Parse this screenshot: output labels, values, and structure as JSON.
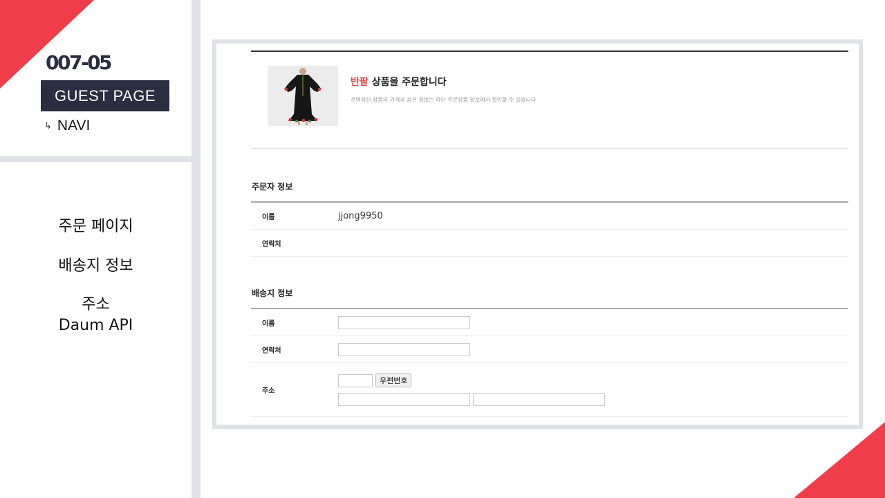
{
  "left_panel": {
    "code": "007-05",
    "badge": "GUEST PAGE",
    "navi_arrow": "↳",
    "navi": "NAVI",
    "menu": [
      {
        "label": "주문 페이지"
      },
      {
        "label": "배송지 정보"
      },
      {
        "label_line1": "주소",
        "label_line2": "Daum API"
      }
    ]
  },
  "screenshot": {
    "product": {
      "title_accent": "반팔",
      "title_rest": "상품을 주문합니다",
      "subtitle": "선택하신 상품의 가격과 옵션 정보는 하단 주문상품 정보에서 확인할 수 있습니다",
      "image_alt": "dress-thumbnail"
    },
    "orderer": {
      "title": "주문자 정보",
      "name_label": "이름",
      "name_value": "jjong9950",
      "phone_label": "연락처",
      "phone_value": ""
    },
    "shipping": {
      "title": "배송지 정보",
      "name_label": "이름",
      "name_value": "",
      "phone_label": "연락처",
      "phone_value": "",
      "address_label": "주소",
      "zip_value": "",
      "zip_button": "우편번호",
      "address1_value": "",
      "address2_value": ""
    }
  },
  "colors": {
    "accent": "#ef3e4a",
    "navy": "#2b2d42",
    "divider": "#dfe1e7"
  }
}
